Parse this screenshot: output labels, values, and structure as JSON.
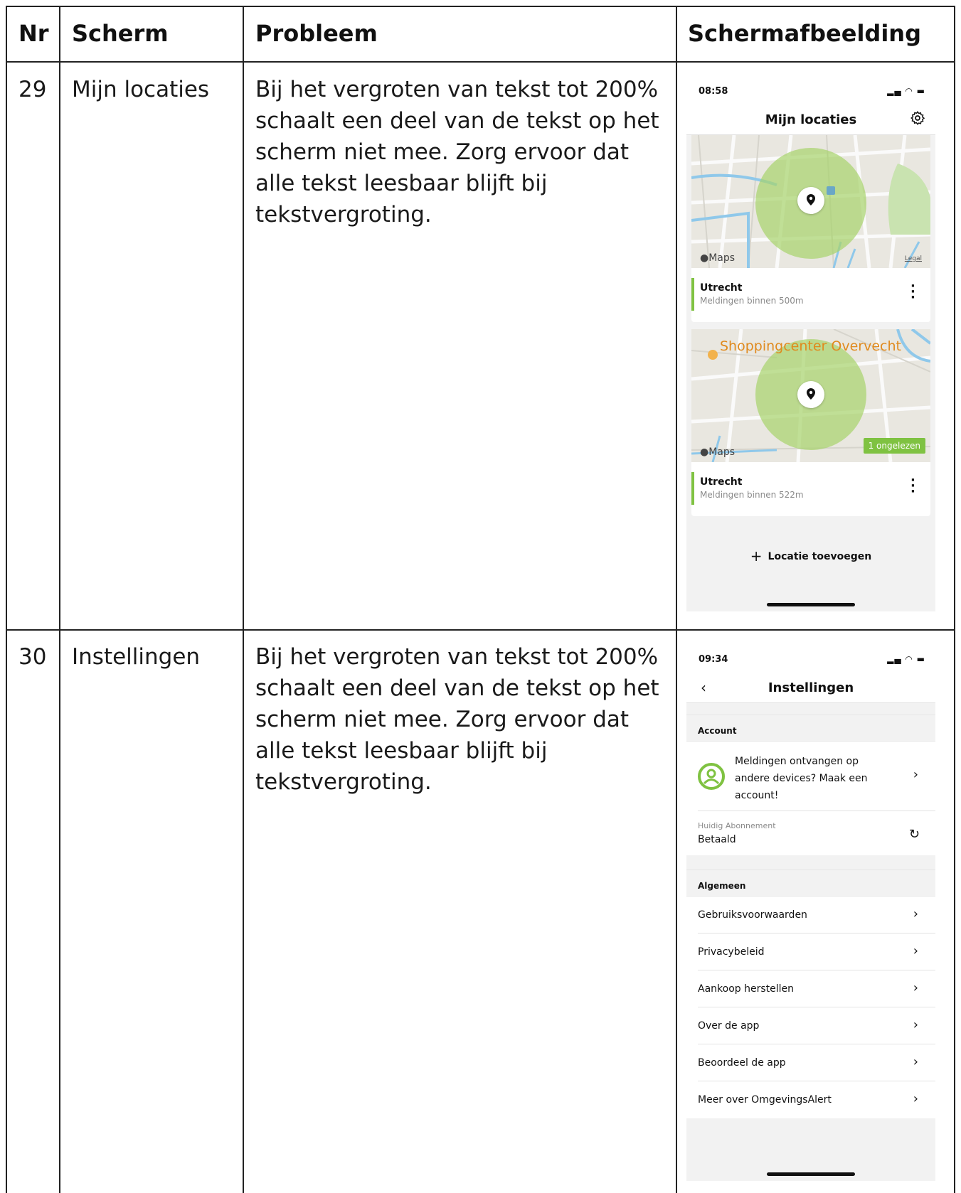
{
  "table": {
    "headers": {
      "nr": "Nr",
      "scherm": "Scherm",
      "probleem": "Probleem",
      "schermafbeelding": "Schermafbeelding"
    },
    "rows": [
      {
        "nr": "29",
        "scherm": "Mijn locaties",
        "probleem": "Bij het vergroten van tekst tot 200% schaalt een deel van de tekst op het scherm niet mee. Zorg ervoor dat alle tekst leesbaar blijft bij tekstvergroting."
      },
      {
        "nr": "30",
        "scherm": "Instellingen",
        "probleem": "Bij het vergroten van tekst tot 200% schaalt een deel van de tekst op het scherm niet mee. Zorg ervoor dat alle tekst leesbaar blijft bij tekstvergroting."
      }
    ]
  },
  "screen1": {
    "time": "08:58",
    "title": "Mijn locaties",
    "map_logo": "Maps",
    "map_legal": "Legal",
    "map_place_label": "Shoppingcenter Overvecht",
    "cards": [
      {
        "name": "Utrecht",
        "subtitle": "Meldingen binnen 500m"
      },
      {
        "name": "Utrecht",
        "subtitle": "Meldingen binnen 522m",
        "badge": "1 ongelezen"
      }
    ],
    "add_label": "Locatie toevoegen"
  },
  "screen2": {
    "time": "09:34",
    "title": "Instellingen",
    "account_section": "Account",
    "account_text": "Meldingen ontvangen op andere devices? Maak een account!",
    "subscription_label": "Huidig Abonnement",
    "subscription_value": "Betaald",
    "general_section": "Algemeen",
    "items": [
      "Gebruiksvoorwaarden",
      "Privacybeleid",
      "Aankoop herstellen",
      "Over de app",
      "Beoordeel de app",
      "Meer over OmgevingsAlert"
    ]
  },
  "colors": {
    "accent_green": "#7fc241",
    "grid_line": "#222222",
    "map_circle": "#a7d36b"
  }
}
